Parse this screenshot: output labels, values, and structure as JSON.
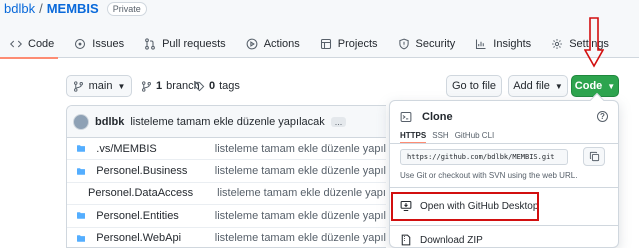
{
  "repo": {
    "owner": "bdlbk",
    "separator": "/",
    "name": "MEMBIS",
    "visibility": "Private"
  },
  "tabs": [
    {
      "label": "Code",
      "icon": "code-icon"
    },
    {
      "label": "Issues",
      "icon": "issue-icon"
    },
    {
      "label": "Pull requests",
      "icon": "pull-request-icon"
    },
    {
      "label": "Actions",
      "icon": "play-icon"
    },
    {
      "label": "Projects",
      "icon": "table-icon"
    },
    {
      "label": "Security",
      "icon": "shield-icon"
    },
    {
      "label": "Insights",
      "icon": "graph-icon"
    },
    {
      "label": "Settings",
      "icon": "gear-icon"
    }
  ],
  "toolbar": {
    "branch": "main",
    "branches_count": "1",
    "branches_label": "branch",
    "tags_count": "0",
    "tags_label": "tags",
    "goto_file": "Go to file",
    "add_file": "Add file",
    "code": "Code"
  },
  "commit": {
    "author": "bdlbk",
    "message": "listeleme tamam ekle düzenle yapılacak",
    "more": "..."
  },
  "files": [
    {
      "name": ".vs/MEMBIS",
      "message": "listeleme tamam ekle düzenle yapıl"
    },
    {
      "name": "Personel.Business",
      "message": "listeleme tamam ekle düzenle yapıl"
    },
    {
      "name": "Personel.DataAccess",
      "message": "listeleme tamam ekle düzenle yapıl"
    },
    {
      "name": "Personel.Entities",
      "message": "listeleme tamam ekle düzenle yapıl"
    },
    {
      "name": "Personel.WebApi",
      "message": "listeleme tamam ekle düzenle yapıl"
    }
  ],
  "clone_menu": {
    "title": "Clone",
    "help": "?",
    "tabs": [
      "HTTPS",
      "SSH",
      "GitHub CLI"
    ],
    "url": "https://github.com/bdlbk/MEMBIS.git",
    "note": "Use Git or checkout with SVN using the web URL.",
    "open_desktop": "Open with GitHub Desktop",
    "download_zip": "Download ZIP"
  },
  "colors": {
    "accent": "#0969da",
    "green_button": "#2da44e",
    "tab_underline": "#fd8c73",
    "annotation_red": "#d20f0f",
    "folder": "#54aeff"
  }
}
